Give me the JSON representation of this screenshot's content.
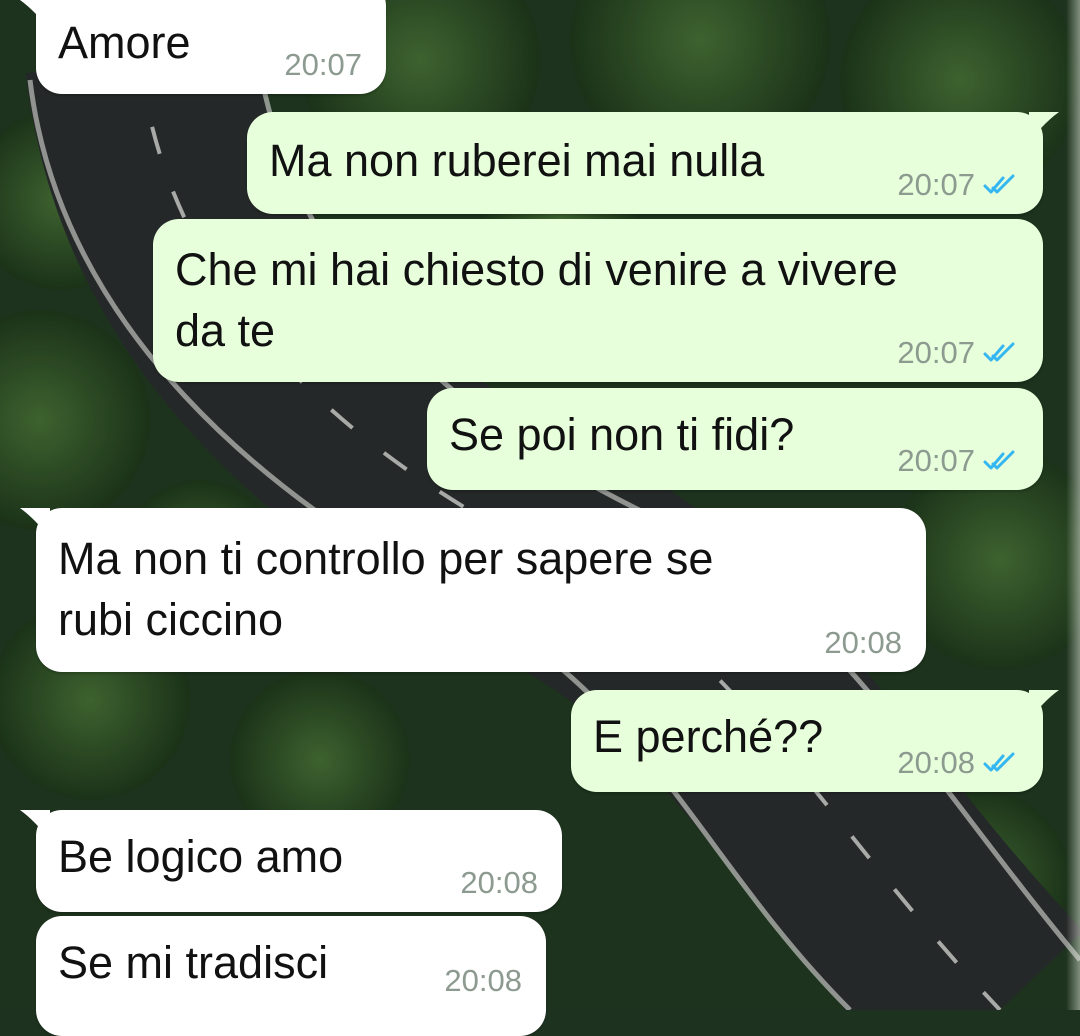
{
  "colors": {
    "incoming_bubble": "#ffffff",
    "outgoing_bubble": "#e7ffdb",
    "timestamp": "#8c9a90",
    "read_ticks": "#34b7f1"
  },
  "wallpaper": {
    "icon": "forest-road-wallpaper"
  },
  "messages": [
    {
      "direction": "in",
      "text": "Amore",
      "time": "20:07",
      "tail": true
    },
    {
      "direction": "out",
      "text": "Ma non ruberei mai nulla",
      "time": "20:07",
      "status": "read",
      "tail": true
    },
    {
      "direction": "out",
      "text": "Che mi hai chiesto di venire a vivere\nda te",
      "time": "20:07",
      "status": "read",
      "tail": false
    },
    {
      "direction": "out",
      "text": "Se poi non ti fidi?",
      "time": "20:07",
      "status": "read",
      "tail": false
    },
    {
      "direction": "in",
      "text": "Ma non ti controllo per sapere se\nrubi ciccino",
      "time": "20:08",
      "tail": true
    },
    {
      "direction": "out",
      "text": "E perché??",
      "time": "20:08",
      "status": "read",
      "tail": true
    },
    {
      "direction": "in",
      "text": "Be logico amo",
      "time": "20:08",
      "tail": true
    },
    {
      "direction": "in",
      "text": "Se mi tradisci",
      "time": "20:08",
      "tail": false
    }
  ]
}
